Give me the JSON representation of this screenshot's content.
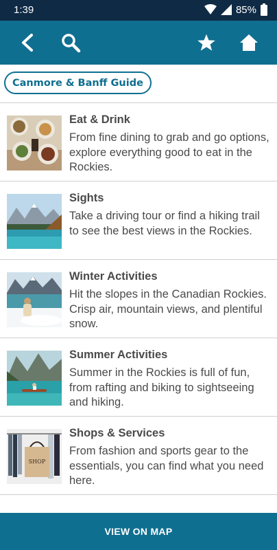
{
  "status_bar": {
    "time": "1:39",
    "battery": "85%"
  },
  "app_bar": {
    "icons": [
      "back-arrow-icon",
      "search-icon",
      "star-icon",
      "home-icon"
    ]
  },
  "chip": {
    "label": "Canmore & Banff Guide"
  },
  "items": [
    {
      "title": "Eat & Drink",
      "description": "From fine dining to grab and go options, explore everything good to eat in the Rockies."
    },
    {
      "title": "Sights",
      "description": "Take a driving tour or find a hiking trail to see the best views in the Rockies."
    },
    {
      "title": "Winter Activities",
      "description": "Hit the slopes in the Canadian Rockies. Crisp air, mountain views, and plentiful snow."
    },
    {
      "title": "Summer Activities",
      "description": "Summer in the Rockies is full of fun, from rafting and biking to sightseeing and hiking."
    },
    {
      "title": "Shops & Services",
      "description": "From fashion and sports gear to the essentials, you can find what you need here."
    }
  ],
  "bottom_button": {
    "label": "VIEW ON MAP"
  },
  "colors": {
    "primary": "#0f6f91",
    "status_bar": "#0f2a45",
    "text": "#4a4a4a",
    "divider": "#cfcfcf"
  }
}
